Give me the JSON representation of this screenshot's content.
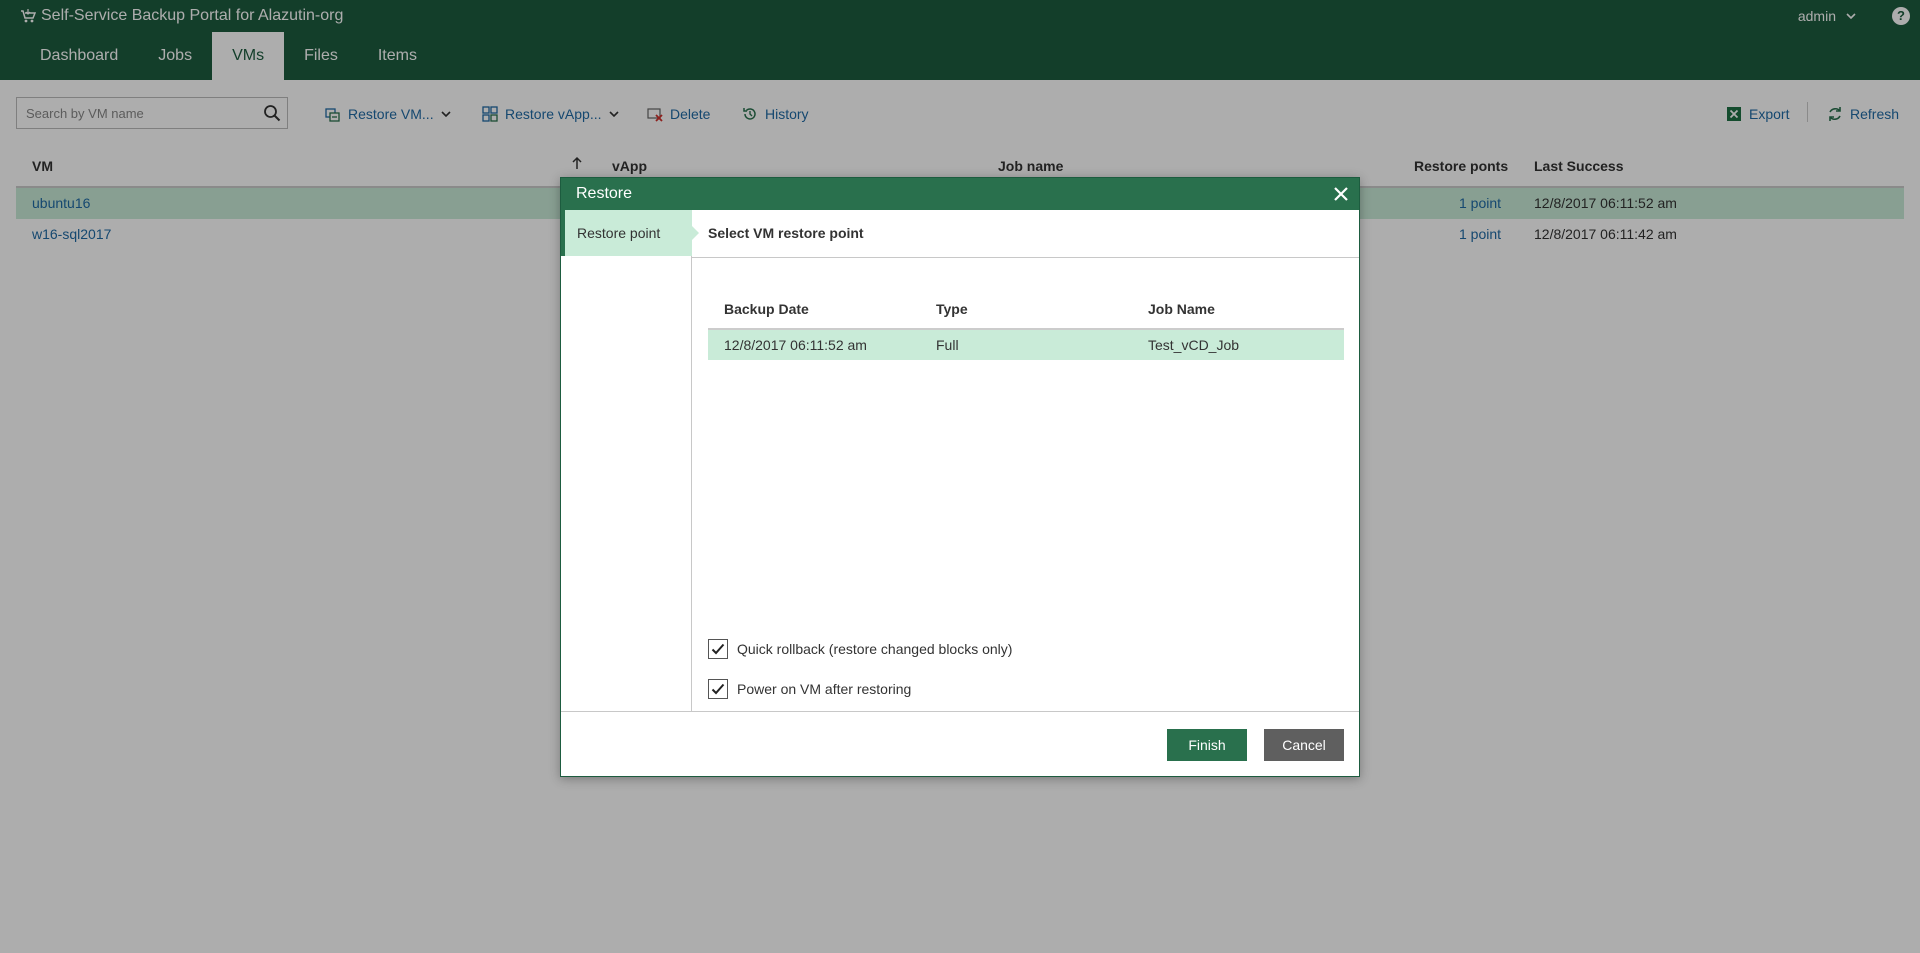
{
  "app": {
    "title": "Self-Service Backup Portal for Alazutin-org",
    "user": "admin",
    "help": "?"
  },
  "nav": {
    "tabs": [
      {
        "label": "Dashboard"
      },
      {
        "label": "Jobs"
      },
      {
        "label": "VMs",
        "active": true
      },
      {
        "label": "Files"
      },
      {
        "label": "Items"
      }
    ]
  },
  "toolbar": {
    "search_placeholder": "Search by VM name",
    "restore_vm": "Restore VM...",
    "restore_vapp": "Restore vApp...",
    "delete": "Delete",
    "history": "History",
    "export": "Export",
    "refresh": "Refresh"
  },
  "grid": {
    "columns": {
      "vm": "VM",
      "vapp": "vApp",
      "job_name": "Job name",
      "restore_points": "Restore ponts",
      "last_success": "Last Success"
    },
    "rows": [
      {
        "vm": "ubuntu16",
        "restore_points": "1 point",
        "last_success": "12/8/2017 06:11:52 am",
        "selected": true
      },
      {
        "vm": "w16-sql2017",
        "restore_points": "1 point",
        "last_success": "12/8/2017 06:11:42 am",
        "selected": false
      }
    ]
  },
  "dialog": {
    "title": "Restore",
    "sidebar_step": "Restore point",
    "step_title": "Select VM restore point",
    "table": {
      "columns": {
        "backup_date": "Backup Date",
        "type": "Type",
        "job_name": "Job Name"
      },
      "rows": [
        {
          "backup_date": "12/8/2017 06:11:52 am",
          "type": "Full",
          "job_name": "Test_vCD_Job"
        }
      ]
    },
    "options": {
      "quick_rollback": "Quick rollback (restore changed blocks only)",
      "power_on": "Power on VM after restoring"
    },
    "buttons": {
      "finish": "Finish",
      "cancel": "Cancel"
    }
  },
  "colors": {
    "header": "#1d5c3f",
    "accent": "#29704d",
    "selection": "#c9ebd8",
    "link": "#1f6aa5"
  }
}
